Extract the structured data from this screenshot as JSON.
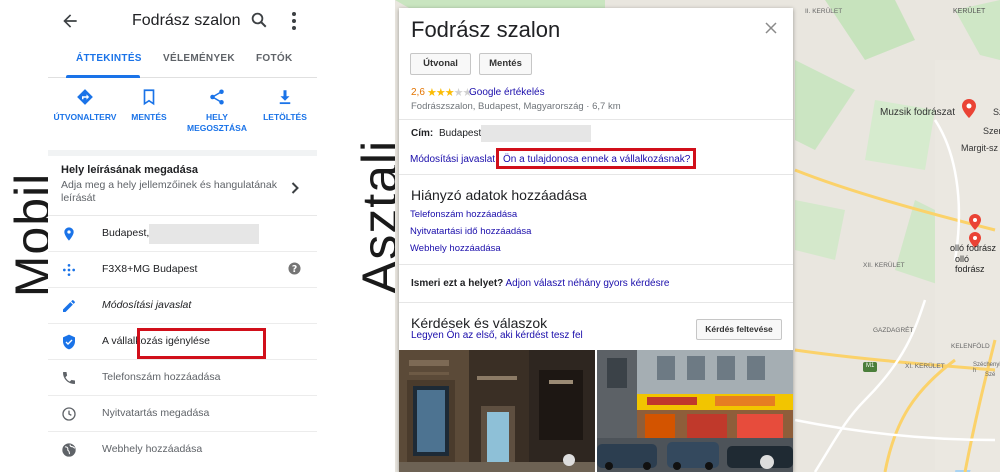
{
  "labels": {
    "mobile": "Mobil",
    "desktop": "Asztali"
  },
  "mobile": {
    "title": "Fodrász szalon",
    "tabs": [
      "ÁTTEKINTÉS",
      "VÉLEMÉNYEK",
      "FOTÓK"
    ],
    "actions": [
      {
        "label_line1": "ÚTVONALTERV",
        "label_line2": "",
        "icon": "directions-icon"
      },
      {
        "label_line1": "MENTÉS",
        "label_line2": "",
        "icon": "bookmark-icon"
      },
      {
        "label_line1": "HELY",
        "label_line2": "MEGOSZTÁSA",
        "icon": "share-icon"
      },
      {
        "label_line1": "LETÖLTÉS",
        "label_line2": "",
        "icon": "download-icon"
      }
    ],
    "description": {
      "title": "Hely leírásának megadása",
      "subtitle": "Adja meg a hely jellemzőinek és hangulatának leírását"
    },
    "rows": [
      {
        "text": "Budapest,",
        "icon": "location-pin-icon"
      },
      {
        "text": "F3X8+MG Budapest",
        "icon": "plus-code-icon"
      },
      {
        "text": "Módosítási javaslat",
        "icon": "pencil-icon"
      },
      {
        "text": "A vállalkozás igénylése",
        "icon": "verified-shield-icon"
      },
      {
        "text": "Telefonszám hozzáadása",
        "icon": "phone-icon"
      },
      {
        "text": "Nyitvatartás megadása",
        "icon": "clock-icon"
      },
      {
        "text": "Webhely hozzáadása",
        "icon": "globe-icon"
      }
    ]
  },
  "desktop": {
    "title": "Fodrász szalon",
    "buttons": {
      "route": "Útvonal",
      "save": "Mentés"
    },
    "rating": "2,6",
    "stars_filled": 2.6,
    "google_reviews": "Google értékelés",
    "subtitle": "Fodrászszalon, Budapest, Magyarország · 6,7 km",
    "address_label": "Cím:",
    "address_value": "Budapest,",
    "suggest_edit": "Módosítási javaslat",
    "owner_link": "Ön a tulajdonosa ennek a vállalkozásnak?",
    "missing_heading": "Hiányzó adatok hozzáadása",
    "missing_links": [
      "Telefonszám hozzáadása",
      "Nyitvatartási idő hozzáadása",
      "Webhely hozzáadása"
    ],
    "know_label": "Ismeri ezt a helyet?",
    "know_link": "Adjon választ néhány gyors kérdésre",
    "qa_heading": "Kérdések és válaszok",
    "qa_link": "Legyen Ön az első, aki kérdést tesz fel",
    "qa_button": "Kérdés feltevése"
  },
  "map": {
    "place_name": "Muzsik fodrászat",
    "labels": [
      "KERÜLET",
      "Margit-sz",
      "XII. KERÜLET",
      "olló fodrász",
      "olló fodrász",
      "GAZDAGRÉT",
      "KELENFÖLD",
      "XI. KERÜLET",
      "M1",
      "Szé",
      "Sz",
      "Szent",
      "Széchenyi-h",
      "II. KERÜLET"
    ]
  },
  "colors": {
    "accent": "#1a73e8",
    "highlight_border": "#d10f1a",
    "link": "#1a0dab",
    "rating": "#e37400"
  }
}
